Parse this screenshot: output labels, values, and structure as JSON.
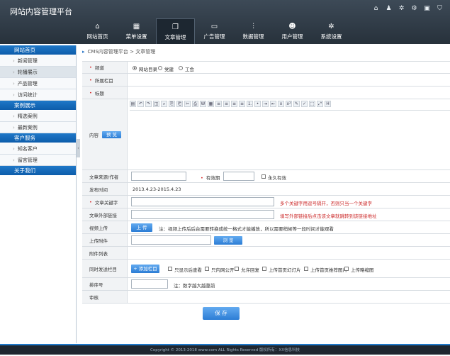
{
  "app": {
    "title": "网站内容管理平台"
  },
  "top_icons": [
    "home-icon",
    "users-icon",
    "gear-icon",
    "settings-icon",
    "inbox-icon",
    "shirt-icon"
  ],
  "nav": [
    {
      "label": "网站首页",
      "icon": "home-icon",
      "glyph": "⌂"
    },
    {
      "label": "菜单设置",
      "icon": "grid-icon",
      "glyph": "▦"
    },
    {
      "label": "文章管理",
      "icon": "copy-icon",
      "glyph": "❐"
    },
    {
      "label": "广告管理",
      "icon": "screen-icon",
      "glyph": "▭"
    },
    {
      "label": "数据管理",
      "icon": "sliders-icon",
      "glyph": "⫶"
    },
    {
      "label": "用户管理",
      "icon": "user-icon",
      "glyph": "☻"
    },
    {
      "label": "系统设置",
      "icon": "gear-icon",
      "glyph": "✲"
    }
  ],
  "sidebar": {
    "group1": "网站首页",
    "items1": [
      "新闻管理",
      "轮播展示",
      "产品管理",
      "访问统计"
    ],
    "group2": "案例展示",
    "items2": [
      "精选案例",
      "最新案例"
    ],
    "group3": "客户服务",
    "items3": [
      "知名客户",
      "留言管理"
    ],
    "group4": "关于我们"
  },
  "breadcrumb": {
    "root": "CMS内容管理平台",
    "sep": ">",
    "current": "文章管理"
  },
  "form": {
    "channel_label": "频道",
    "channel_options": [
      "网站目录",
      "党建",
      "工会"
    ],
    "column_label": "所属栏目",
    "title_label": "标题",
    "content_label": "内容",
    "preview_btn": "预 览",
    "source_label": "文章来源/作者",
    "validity_label": "有效期",
    "permanent_label": "永久有效",
    "publish_time_label": "发布时间",
    "publish_time_value": "2013.4.23-2015.4.23",
    "keywords_label": "文章关键字",
    "keywords_note": "多个关键字用逗号隔开，否则只当一个关键字",
    "external_link_label": "文章外部链接",
    "external_link_note": "填写外部链接后点击该文章就跳转到该链接地址",
    "video_label": "视频上传",
    "upload_btn": "上 传",
    "video_note": "注：视频上传后后台需要转换成统一格式才能播放，所以需要稍候等一段时间才能观看",
    "attachment_label": "上传附件",
    "browse_btn": "浏 览",
    "attachment_list_label": "附件列表",
    "sync_label": "同时发送栏目",
    "add_column_btn": "+ 添加栏目",
    "sync_options": [
      "只显示后查看",
      "只内网公开",
      "允许回复",
      "上传首页幻灯片",
      "上传首页推荐图片",
      "上传略缩图"
    ],
    "sort_label": "排序号",
    "sort_note": "注：数字越大越靠前",
    "review_label": "审核",
    "save_btn": "保 存"
  },
  "editor_toolbar": [
    "source-icon",
    "undo-icon",
    "redo-icon",
    "preview-icon",
    "find-icon",
    "paste-icon",
    "copy-icon",
    "cut-icon",
    "paste-text-icon",
    "paste-word-icon",
    "table-icon",
    "align-left-icon",
    "align-center-icon",
    "align-right-icon",
    "justify-icon",
    "ordered-list-icon",
    "unordered-list-icon",
    "indent-icon",
    "outdent-icon",
    "subscript-icon",
    "superscript-icon",
    "clear-format-icon",
    "spellcheck-icon",
    "select-all-icon",
    "fullscreen-icon",
    "heading-icon"
  ],
  "editor_glyphs": [
    "▤",
    "↶",
    "↷",
    "◫",
    "⌕",
    "⎘",
    "⎗",
    "✂",
    "⎙",
    "W",
    "▦",
    "≡",
    "≡",
    "≡",
    "≡",
    "⒈",
    "•",
    "⇥",
    "⇤",
    "x",
    "x²",
    "✎",
    "✓",
    "⬚",
    "⤢",
    "H"
  ],
  "footer": {
    "text": "Copyright © 2013-2018 www.com ALL Rights Reserved 版权所有：XX信息科技"
  },
  "colors": {
    "accent": "#1f78c8",
    "header": "#2f3a45",
    "required": "#d62323"
  }
}
